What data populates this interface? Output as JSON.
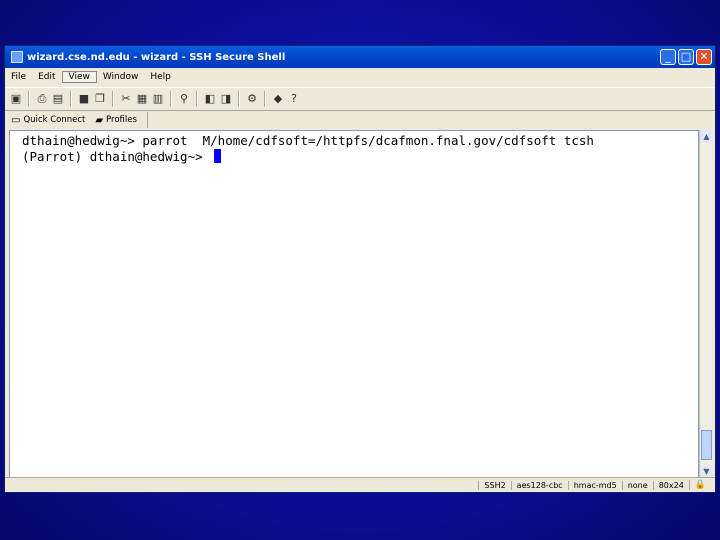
{
  "window": {
    "title": "wizard.cse.nd.edu - wizard - SSH Secure Shell",
    "minimize": "_",
    "maximize": "□",
    "close": "✕"
  },
  "menu": [
    {
      "label": "File"
    },
    {
      "label": "Edit"
    },
    {
      "label": "View"
    },
    {
      "label": "Window"
    },
    {
      "label": "Help"
    }
  ],
  "toolbar": {
    "icons": [
      "save-icon",
      "print-icon",
      "print-preview-icon",
      "lock-icon",
      "copy-icon",
      "paste-icon",
      "paste-special-icon",
      "find-icon",
      "new-terminal-icon",
      "new-file-transfer-icon",
      "settings-icon",
      "help-book-icon",
      "help-icon"
    ]
  },
  "quickbar": {
    "quick_connect": "Quick Connect",
    "profiles": "Profiles"
  },
  "terminal": {
    "lines": [
      "dthain@hedwig~> parrot  M/home/cdfsoft=/httpfs/dcafmon.fnal.gov/cdfsoft tcsh",
      "(Parrot) dthain@hedwig~> "
    ]
  },
  "statusbar": {
    "protocol": "SSH2",
    "cipher": "aes128-cbc",
    "mac": "hmac-md5",
    "compression": "none",
    "size": "80x24"
  },
  "colors": {
    "background": "#0e0e9a",
    "titlebar": "#0245c8",
    "cursor": "#0000ff"
  }
}
